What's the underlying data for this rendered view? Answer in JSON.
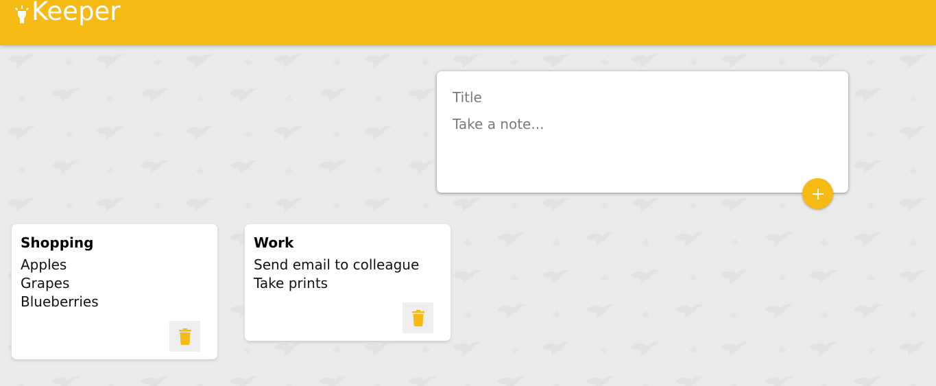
{
  "app": {
    "name": "Keeper",
    "brand_color": "#f5ba13",
    "logo_icon": "highlight-icon"
  },
  "create_note": {
    "title_placeholder": "Title",
    "content_placeholder": "Take a note...",
    "title_value": "",
    "content_value": "",
    "add_icon": "add-icon"
  },
  "notes": [
    {
      "title": "Shopping",
      "lines": [
        "Apples",
        "Grapes",
        "Blueberries"
      ],
      "delete_icon": "delete-icon"
    },
    {
      "title": "Work",
      "lines": [
        "Send email to colleague",
        "Take prints"
      ],
      "delete_icon": "delete-icon"
    }
  ]
}
